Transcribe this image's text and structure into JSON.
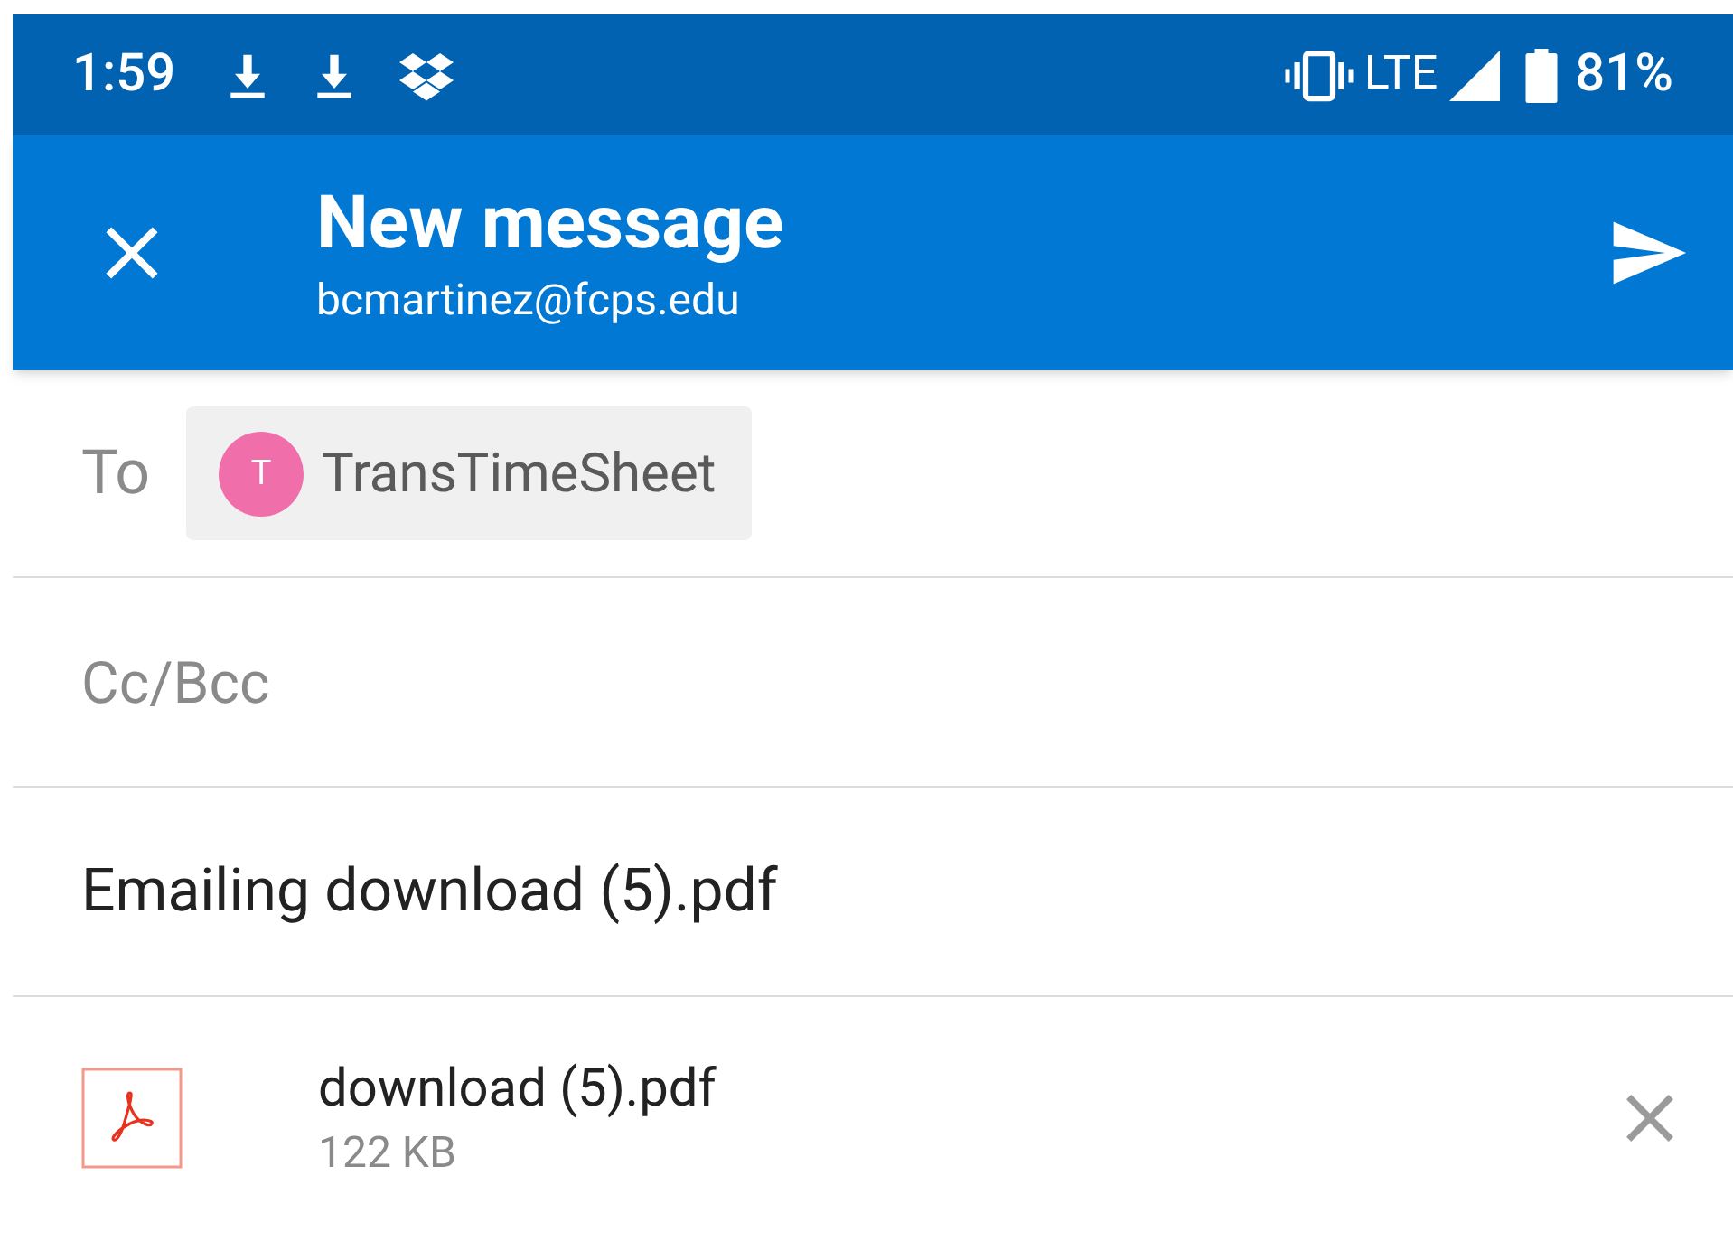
{
  "status_bar": {
    "time": "1:59",
    "network": "LTE",
    "battery": "81%"
  },
  "app_bar": {
    "title": "New message",
    "account": "bcmartinez@fcps.edu"
  },
  "to": {
    "label": "To",
    "recipients": [
      {
        "initial": "T",
        "name": "TransTimeSheet",
        "color": "#f06eaa"
      }
    ]
  },
  "cc": {
    "placeholder": "Cc/Bcc"
  },
  "subject": {
    "value": "Emailing download (5).pdf"
  },
  "attachments": [
    {
      "name": "download (5).pdf",
      "size": "122 KB"
    }
  ]
}
